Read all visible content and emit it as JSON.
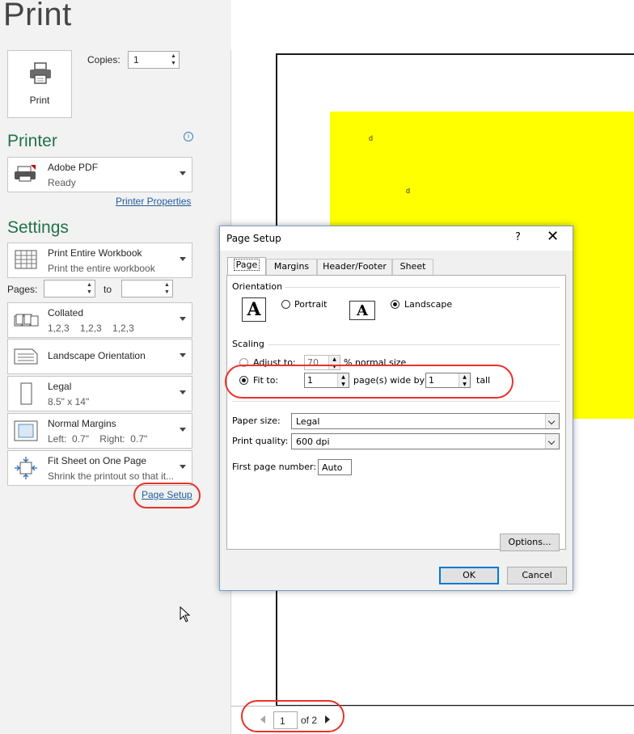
{
  "backstage": {
    "title": "Print",
    "print_button_label": "Print",
    "copies": {
      "label": "Copies:",
      "value": "1"
    }
  },
  "printer": {
    "heading": "Printer",
    "name": "Adobe PDF",
    "status": "Ready",
    "properties_link": "Printer Properties"
  },
  "settings": {
    "heading": "Settings",
    "print_what": {
      "title": "Print Entire Workbook",
      "subtitle": "Print the entire workbook"
    },
    "pages_label": "Pages:",
    "to_label": "to",
    "collation": {
      "title": "Collated",
      "subtitle": "1,2,3    1,2,3    1,2,3"
    },
    "orientation": {
      "title": "Landscape Orientation"
    },
    "paper": {
      "title": "Legal",
      "subtitle": "8.5\" x 14\""
    },
    "margins": {
      "title": "Normal Margins",
      "subtitle": "Left:  0.7\"    Right:  0.7\""
    },
    "scaling": {
      "title": "Fit Sheet on One Page",
      "subtitle": "Shrink the printout so that it..."
    },
    "page_setup_link": "Page Setup"
  },
  "preview": {
    "cell_texts": [
      "d",
      "d"
    ],
    "highlight_color": "#ffff00",
    "current_page": "1",
    "of_pages": "of 2"
  },
  "dialog": {
    "title": "Page Setup",
    "help_glyph": "?",
    "close_glyph": "✕",
    "tabs": [
      "Page",
      "Margins",
      "Header/Footer",
      "Sheet"
    ],
    "active_tab": "Page",
    "orientation_label": "Orientation",
    "portrait_label": "Portrait",
    "landscape_label": "Landscape",
    "orientation_selected": "Landscape",
    "scaling_label": "Scaling",
    "adjust_to_label": "Adjust to:",
    "adjust_to_value": "70",
    "adjust_to_suffix": "% normal size",
    "fit_to_label": "Fit to:",
    "fit_wide_value": "1",
    "pages_wide_label": "page(s) wide by",
    "fit_tall_value": "1",
    "tall_label": "tall",
    "scaling_selected": "Fit to",
    "paper_size_label": "Paper size:",
    "paper_size_value": "Legal",
    "print_quality_label": "Print quality:",
    "print_quality_value": "600 dpi",
    "first_page_label": "First page number:",
    "first_page_value": "Auto",
    "options_button": "Options...",
    "ok_button": "OK",
    "cancel_button": "Cancel"
  },
  "colors": {
    "accent_green": "#21734a",
    "link_blue": "#1f5c99",
    "annotation_red": "#e8322b"
  }
}
